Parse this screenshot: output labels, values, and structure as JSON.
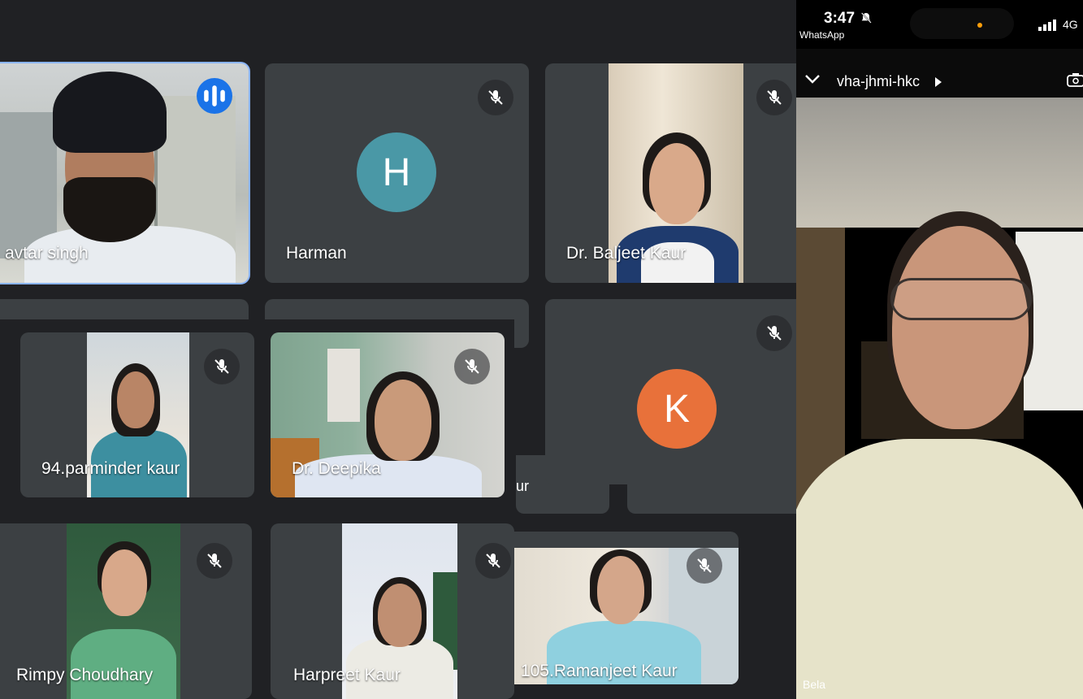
{
  "meet": {
    "participants": [
      {
        "name": "avtar singh",
        "state": "speaking"
      },
      {
        "name": "Harman",
        "state": "muted",
        "avatar_letter": "H",
        "avatar_color": "#4a98a6"
      },
      {
        "name": "Dr. Baljeet Kaur",
        "state": "muted"
      },
      {
        "name": "",
        "state": "muted",
        "avatar_letter": "K",
        "avatar_color": "#e8713a"
      },
      {
        "name": "94.parminder kaur",
        "state": "muted"
      },
      {
        "name": "Dr. Deepika",
        "state": "muted"
      },
      {
        "name": "Rimpy Choudhary",
        "state": "muted"
      },
      {
        "name": "Harpreet Kaur",
        "state": "muted"
      },
      {
        "name": "105.Ramanjeet Kaur",
        "state": "muted"
      }
    ],
    "partial_text": "ur"
  },
  "phone": {
    "status": {
      "time": "3:47",
      "app": "WhatsApp",
      "network": "4G"
    },
    "call": {
      "title": "vha-jhmi-hkc"
    },
    "participant_name": "Bela"
  },
  "colors": {
    "meet_bg": "#202124",
    "tile_bg": "#3c4043",
    "speaking_outline": "#8ab4f8",
    "speaking_indicator": "#1a73e8"
  }
}
